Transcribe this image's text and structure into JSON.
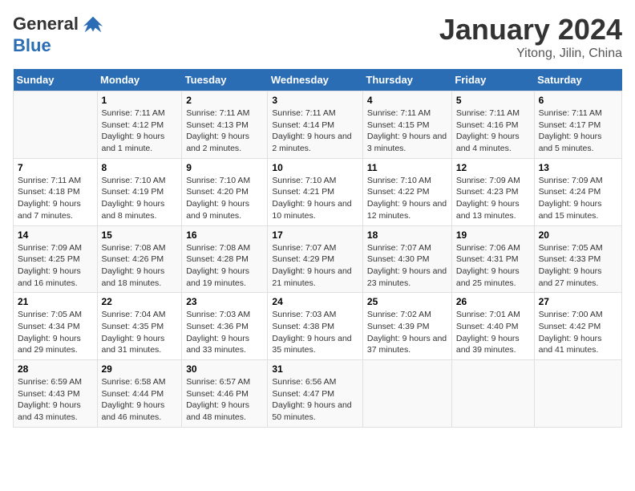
{
  "header": {
    "logo_general": "General",
    "logo_blue": "Blue",
    "main_title": "January 2024",
    "subtitle": "Yitong, Jilin, China"
  },
  "weekdays": [
    "Sunday",
    "Monday",
    "Tuesday",
    "Wednesday",
    "Thursday",
    "Friday",
    "Saturday"
  ],
  "weeks": [
    [
      {
        "day": "",
        "sunrise": "",
        "sunset": "",
        "daylight": ""
      },
      {
        "day": "1",
        "sunrise": "Sunrise: 7:11 AM",
        "sunset": "Sunset: 4:12 PM",
        "daylight": "Daylight: 9 hours and 1 minute."
      },
      {
        "day": "2",
        "sunrise": "Sunrise: 7:11 AM",
        "sunset": "Sunset: 4:13 PM",
        "daylight": "Daylight: 9 hours and 2 minutes."
      },
      {
        "day": "3",
        "sunrise": "Sunrise: 7:11 AM",
        "sunset": "Sunset: 4:14 PM",
        "daylight": "Daylight: 9 hours and 2 minutes."
      },
      {
        "day": "4",
        "sunrise": "Sunrise: 7:11 AM",
        "sunset": "Sunset: 4:15 PM",
        "daylight": "Daylight: 9 hours and 3 minutes."
      },
      {
        "day": "5",
        "sunrise": "Sunrise: 7:11 AM",
        "sunset": "Sunset: 4:16 PM",
        "daylight": "Daylight: 9 hours and 4 minutes."
      },
      {
        "day": "6",
        "sunrise": "Sunrise: 7:11 AM",
        "sunset": "Sunset: 4:17 PM",
        "daylight": "Daylight: 9 hours and 5 minutes."
      }
    ],
    [
      {
        "day": "7",
        "sunrise": "Sunrise: 7:11 AM",
        "sunset": "Sunset: 4:18 PM",
        "daylight": "Daylight: 9 hours and 7 minutes."
      },
      {
        "day": "8",
        "sunrise": "Sunrise: 7:10 AM",
        "sunset": "Sunset: 4:19 PM",
        "daylight": "Daylight: 9 hours and 8 minutes."
      },
      {
        "day": "9",
        "sunrise": "Sunrise: 7:10 AM",
        "sunset": "Sunset: 4:20 PM",
        "daylight": "Daylight: 9 hours and 9 minutes."
      },
      {
        "day": "10",
        "sunrise": "Sunrise: 7:10 AM",
        "sunset": "Sunset: 4:21 PM",
        "daylight": "Daylight: 9 hours and 10 minutes."
      },
      {
        "day": "11",
        "sunrise": "Sunrise: 7:10 AM",
        "sunset": "Sunset: 4:22 PM",
        "daylight": "Daylight: 9 hours and 12 minutes."
      },
      {
        "day": "12",
        "sunrise": "Sunrise: 7:09 AM",
        "sunset": "Sunset: 4:23 PM",
        "daylight": "Daylight: 9 hours and 13 minutes."
      },
      {
        "day": "13",
        "sunrise": "Sunrise: 7:09 AM",
        "sunset": "Sunset: 4:24 PM",
        "daylight": "Daylight: 9 hours and 15 minutes."
      }
    ],
    [
      {
        "day": "14",
        "sunrise": "Sunrise: 7:09 AM",
        "sunset": "Sunset: 4:25 PM",
        "daylight": "Daylight: 9 hours and 16 minutes."
      },
      {
        "day": "15",
        "sunrise": "Sunrise: 7:08 AM",
        "sunset": "Sunset: 4:26 PM",
        "daylight": "Daylight: 9 hours and 18 minutes."
      },
      {
        "day": "16",
        "sunrise": "Sunrise: 7:08 AM",
        "sunset": "Sunset: 4:28 PM",
        "daylight": "Daylight: 9 hours and 19 minutes."
      },
      {
        "day": "17",
        "sunrise": "Sunrise: 7:07 AM",
        "sunset": "Sunset: 4:29 PM",
        "daylight": "Daylight: 9 hours and 21 minutes."
      },
      {
        "day": "18",
        "sunrise": "Sunrise: 7:07 AM",
        "sunset": "Sunset: 4:30 PM",
        "daylight": "Daylight: 9 hours and 23 minutes."
      },
      {
        "day": "19",
        "sunrise": "Sunrise: 7:06 AM",
        "sunset": "Sunset: 4:31 PM",
        "daylight": "Daylight: 9 hours and 25 minutes."
      },
      {
        "day": "20",
        "sunrise": "Sunrise: 7:05 AM",
        "sunset": "Sunset: 4:33 PM",
        "daylight": "Daylight: 9 hours and 27 minutes."
      }
    ],
    [
      {
        "day": "21",
        "sunrise": "Sunrise: 7:05 AM",
        "sunset": "Sunset: 4:34 PM",
        "daylight": "Daylight: 9 hours and 29 minutes."
      },
      {
        "day": "22",
        "sunrise": "Sunrise: 7:04 AM",
        "sunset": "Sunset: 4:35 PM",
        "daylight": "Daylight: 9 hours and 31 minutes."
      },
      {
        "day": "23",
        "sunrise": "Sunrise: 7:03 AM",
        "sunset": "Sunset: 4:36 PM",
        "daylight": "Daylight: 9 hours and 33 minutes."
      },
      {
        "day": "24",
        "sunrise": "Sunrise: 7:03 AM",
        "sunset": "Sunset: 4:38 PM",
        "daylight": "Daylight: 9 hours and 35 minutes."
      },
      {
        "day": "25",
        "sunrise": "Sunrise: 7:02 AM",
        "sunset": "Sunset: 4:39 PM",
        "daylight": "Daylight: 9 hours and 37 minutes."
      },
      {
        "day": "26",
        "sunrise": "Sunrise: 7:01 AM",
        "sunset": "Sunset: 4:40 PM",
        "daylight": "Daylight: 9 hours and 39 minutes."
      },
      {
        "day": "27",
        "sunrise": "Sunrise: 7:00 AM",
        "sunset": "Sunset: 4:42 PM",
        "daylight": "Daylight: 9 hours and 41 minutes."
      }
    ],
    [
      {
        "day": "28",
        "sunrise": "Sunrise: 6:59 AM",
        "sunset": "Sunset: 4:43 PM",
        "daylight": "Daylight: 9 hours and 43 minutes."
      },
      {
        "day": "29",
        "sunrise": "Sunrise: 6:58 AM",
        "sunset": "Sunset: 4:44 PM",
        "daylight": "Daylight: 9 hours and 46 minutes."
      },
      {
        "day": "30",
        "sunrise": "Sunrise: 6:57 AM",
        "sunset": "Sunset: 4:46 PM",
        "daylight": "Daylight: 9 hours and 48 minutes."
      },
      {
        "day": "31",
        "sunrise": "Sunrise: 6:56 AM",
        "sunset": "Sunset: 4:47 PM",
        "daylight": "Daylight: 9 hours and 50 minutes."
      },
      {
        "day": "",
        "sunrise": "",
        "sunset": "",
        "daylight": ""
      },
      {
        "day": "",
        "sunrise": "",
        "sunset": "",
        "daylight": ""
      },
      {
        "day": "",
        "sunrise": "",
        "sunset": "",
        "daylight": ""
      }
    ]
  ]
}
